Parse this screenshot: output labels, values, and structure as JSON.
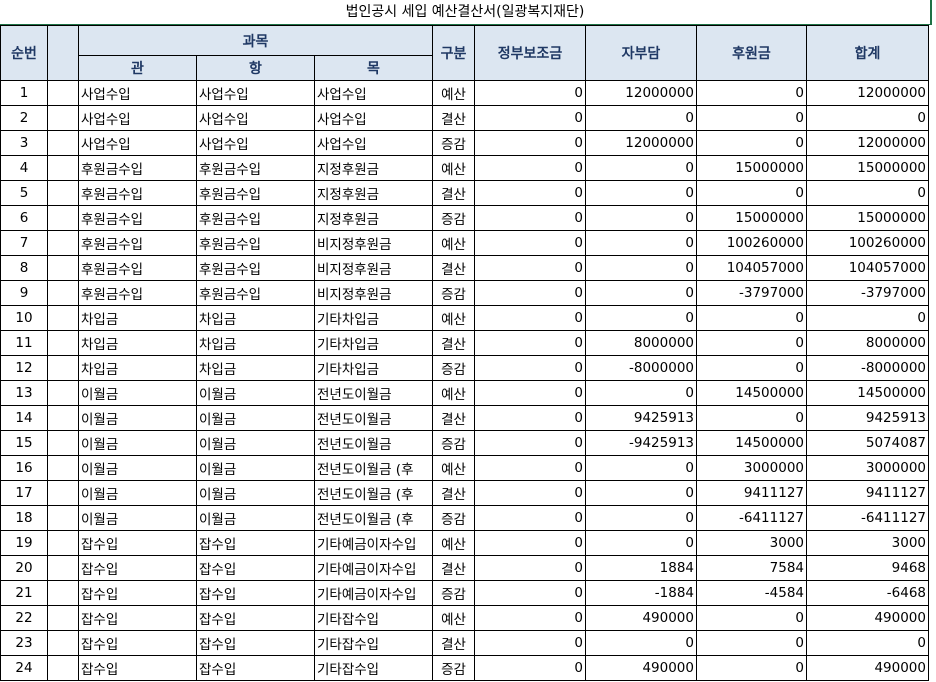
{
  "title": "법인공시 세입 예산결산서(일광복지재단)",
  "headers": {
    "seq": "순번",
    "subject": "과목",
    "gwan": "관",
    "hang": "항",
    "mok": "목",
    "type": "구분",
    "gov": "정부보조금",
    "self": "자부담",
    "donation": "후원금",
    "total": "합계"
  },
  "rows": [
    {
      "seq": "1",
      "gwan": "사업수입",
      "hang": "사업수입",
      "mok": "사업수입",
      "type": "예산",
      "gov": "0",
      "self": "12000000",
      "donation": "0",
      "total": "12000000"
    },
    {
      "seq": "2",
      "gwan": "사업수입",
      "hang": "사업수입",
      "mok": "사업수입",
      "type": "결산",
      "gov": "0",
      "self": "0",
      "donation": "0",
      "total": "0"
    },
    {
      "seq": "3",
      "gwan": "사업수입",
      "hang": "사업수입",
      "mok": "사업수입",
      "type": "증감",
      "gov": "0",
      "self": "12000000",
      "donation": "0",
      "total": "12000000"
    },
    {
      "seq": "4",
      "gwan": "후원금수입",
      "hang": "후원금수입",
      "mok": "지정후원금",
      "type": "예산",
      "gov": "0",
      "self": "0",
      "donation": "15000000",
      "total": "15000000"
    },
    {
      "seq": "5",
      "gwan": "후원금수입",
      "hang": "후원금수입",
      "mok": "지정후원금",
      "type": "결산",
      "gov": "0",
      "self": "0",
      "donation": "0",
      "total": "0"
    },
    {
      "seq": "6",
      "gwan": "후원금수입",
      "hang": "후원금수입",
      "mok": "지정후원금",
      "type": "증감",
      "gov": "0",
      "self": "0",
      "donation": "15000000",
      "total": "15000000"
    },
    {
      "seq": "7",
      "gwan": "후원금수입",
      "hang": "후원금수입",
      "mok": "비지정후원금",
      "type": "예산",
      "gov": "0",
      "self": "0",
      "donation": "100260000",
      "total": "100260000"
    },
    {
      "seq": "8",
      "gwan": "후원금수입",
      "hang": "후원금수입",
      "mok": "비지정후원금",
      "type": "결산",
      "gov": "0",
      "self": "0",
      "donation": "104057000",
      "total": "104057000"
    },
    {
      "seq": "9",
      "gwan": "후원금수입",
      "hang": "후원금수입",
      "mok": "비지정후원금",
      "type": "증감",
      "gov": "0",
      "self": "0",
      "donation": "-3797000",
      "total": "-3797000"
    },
    {
      "seq": "10",
      "gwan": "차입금",
      "hang": "차입금",
      "mok": "기타차입금",
      "type": "예산",
      "gov": "0",
      "self": "0",
      "donation": "0",
      "total": "0"
    },
    {
      "seq": "11",
      "gwan": "차입금",
      "hang": "차입금",
      "mok": "기타차입금",
      "type": "결산",
      "gov": "0",
      "self": "8000000",
      "donation": "0",
      "total": "8000000"
    },
    {
      "seq": "12",
      "gwan": "차입금",
      "hang": "차입금",
      "mok": "기타차입금",
      "type": "증감",
      "gov": "0",
      "self": "-8000000",
      "donation": "0",
      "total": "-8000000"
    },
    {
      "seq": "13",
      "gwan": "이월금",
      "hang": "이월금",
      "mok": "전년도이월금",
      "type": "예산",
      "gov": "0",
      "self": "0",
      "donation": "14500000",
      "total": "14500000"
    },
    {
      "seq": "14",
      "gwan": "이월금",
      "hang": "이월금",
      "mok": "전년도이월금",
      "type": "결산",
      "gov": "0",
      "self": "9425913",
      "donation": "0",
      "total": "9425913"
    },
    {
      "seq": "15",
      "gwan": "이월금",
      "hang": "이월금",
      "mok": "전년도이월금",
      "type": "증감",
      "gov": "0",
      "self": "-9425913",
      "donation": "14500000",
      "total": "5074087"
    },
    {
      "seq": "16",
      "gwan": "이월금",
      "hang": "이월금",
      "mok": "전년도이월금 (후",
      "type": "예산",
      "gov": "0",
      "self": "0",
      "donation": "3000000",
      "total": "3000000"
    },
    {
      "seq": "17",
      "gwan": "이월금",
      "hang": "이월금",
      "mok": "전년도이월금 (후",
      "type": "결산",
      "gov": "0",
      "self": "0",
      "donation": "9411127",
      "total": "9411127"
    },
    {
      "seq": "18",
      "gwan": "이월금",
      "hang": "이월금",
      "mok": "전년도이월금 (후",
      "type": "증감",
      "gov": "0",
      "self": "0",
      "donation": "-6411127",
      "total": "-6411127"
    },
    {
      "seq": "19",
      "gwan": "잡수입",
      "hang": "잡수입",
      "mok": "기타예금이자수입",
      "type": "예산",
      "gov": "0",
      "self": "0",
      "donation": "3000",
      "total": "3000"
    },
    {
      "seq": "20",
      "gwan": "잡수입",
      "hang": "잡수입",
      "mok": "기타예금이자수입",
      "type": "결산",
      "gov": "0",
      "self": "1884",
      "donation": "7584",
      "total": "9468"
    },
    {
      "seq": "21",
      "gwan": "잡수입",
      "hang": "잡수입",
      "mok": "기타예금이자수입",
      "type": "증감",
      "gov": "0",
      "self": "-1884",
      "donation": "-4584",
      "total": "-6468"
    },
    {
      "seq": "22",
      "gwan": "잡수입",
      "hang": "잡수입",
      "mok": "기타잡수입",
      "type": "예산",
      "gov": "0",
      "self": "490000",
      "donation": "0",
      "total": "490000"
    },
    {
      "seq": "23",
      "gwan": "잡수입",
      "hang": "잡수입",
      "mok": "기타잡수입",
      "type": "결산",
      "gov": "0",
      "self": "0",
      "donation": "0",
      "total": "0"
    },
    {
      "seq": "24",
      "gwan": "잡수입",
      "hang": "잡수입",
      "mok": "기타잡수입",
      "type": "증감",
      "gov": "0",
      "self": "490000",
      "donation": "0",
      "total": "490000"
    }
  ]
}
